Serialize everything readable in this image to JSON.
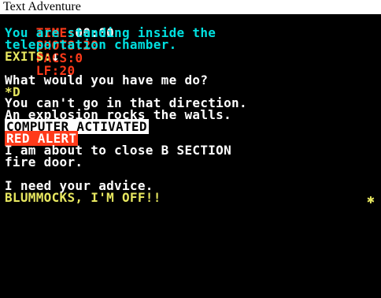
{
  "app": {
    "title": "Text Adventure"
  },
  "status": {
    "time_label": "TIME:",
    "time_value": "00:00",
    "shots_label": "SHOTS:",
    "shots_value": "20",
    "pacs_label": "PACS:",
    "pacs_value": "0",
    "lf_label": "LF:",
    "lf_value": "20"
  },
  "room": {
    "line1": "You are standing inside the",
    "line2": "teleportation chamber.",
    "exits_label": "EXITS:",
    "exits_arrow": "↓"
  },
  "dialogue": {
    "prompt_question": "What would you have me do?",
    "player_input": "D",
    "response1": "You can't go in that direction.",
    "response2": "An explosion rocks the walls.",
    "computer_status": "COMPUTER ACTIVATED",
    "alert": "RED ALERT",
    "computer_line1": "I am about to close B SECTION",
    "computer_line2": "fire door.",
    "computer_line3": "I need your advice.",
    "player_reply": "BLUMMOCKS, I'M OFF!!"
  },
  "colors": {
    "background": "#000000",
    "cyan": "#00e0e0",
    "yellow": "#e8e860",
    "red": "#ff3a1a",
    "white": "#ffffff"
  }
}
